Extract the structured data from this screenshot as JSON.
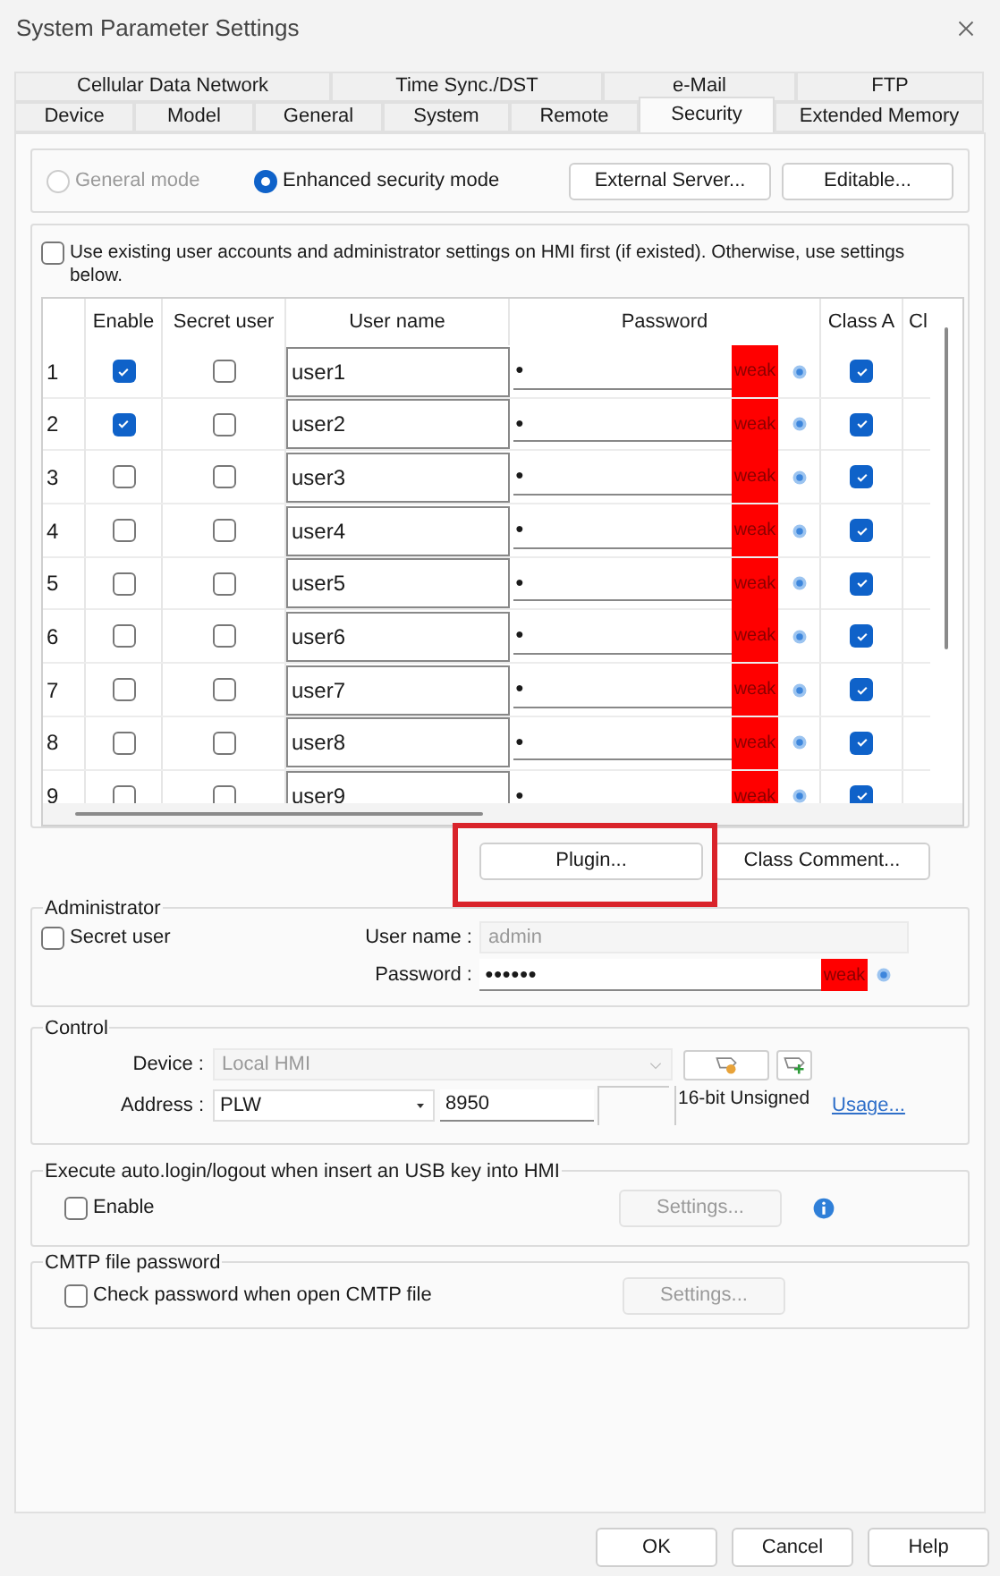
{
  "window": {
    "title": "System Parameter Settings"
  },
  "tab_rows": [
    [
      {
        "label": "Cellular Data Network",
        "selected": false
      },
      {
        "label": "Time Sync./DST",
        "selected": false
      },
      {
        "label": "e-Mail",
        "selected": false
      },
      {
        "label": "FTP",
        "selected": false
      }
    ],
    [
      {
        "label": "Device",
        "selected": false
      },
      {
        "label": "Model",
        "selected": false
      },
      {
        "label": "General",
        "selected": false
      },
      {
        "label": "System",
        "selected": false
      },
      {
        "label": "Remote",
        "selected": false
      },
      {
        "label": "Security",
        "selected": true
      },
      {
        "label": "Extended Memory",
        "selected": false
      }
    ]
  ],
  "modes": [
    {
      "label": "General mode",
      "selected": false,
      "disabled": true
    },
    {
      "label": "Enhanced security mode",
      "selected": true,
      "disabled": false
    }
  ],
  "mode_buttons": [
    "External Server...",
    "Editable..."
  ],
  "use_existing": {
    "label": "Use existing user accounts and administrator settings on HMI first (if existed). Otherwise, use settings below.",
    "checked": false
  },
  "users_table": {
    "columns": [
      "Enable",
      "Secret user",
      "User name",
      "Password",
      "Class A",
      "Cl"
    ],
    "rows": [
      {
        "number": "1",
        "enable": true,
        "secret": false,
        "user_name": "user1",
        "password": "●",
        "strength": "weak",
        "class_a": true
      },
      {
        "number": "2",
        "enable": true,
        "secret": false,
        "user_name": "user2",
        "password": "●",
        "strength": "weak",
        "class_a": true
      },
      {
        "number": "3",
        "enable": false,
        "secret": false,
        "user_name": "user3",
        "password": "●",
        "strength": "weak",
        "class_a": true
      },
      {
        "number": "4",
        "enable": false,
        "secret": false,
        "user_name": "user4",
        "password": "●",
        "strength": "weak",
        "class_a": true
      },
      {
        "number": "5",
        "enable": false,
        "secret": false,
        "user_name": "user5",
        "password": "●",
        "strength": "weak",
        "class_a": true
      },
      {
        "number": "6",
        "enable": false,
        "secret": false,
        "user_name": "user6",
        "password": "●",
        "strength": "weak",
        "class_a": true
      },
      {
        "number": "7",
        "enable": false,
        "secret": false,
        "user_name": "user7",
        "password": "●",
        "strength": "weak",
        "class_a": true
      },
      {
        "number": "8",
        "enable": false,
        "secret": false,
        "user_name": "user8",
        "password": "●",
        "strength": "weak",
        "class_a": true
      },
      {
        "number": "9",
        "enable": false,
        "secret": false,
        "user_name": "user9",
        "password": "●",
        "strength": "weak",
        "class_a": true
      }
    ]
  },
  "table_buttons": [
    {
      "label": "Plugin...",
      "highlighted": true
    },
    {
      "label": "Class Comment...",
      "highlighted": false
    }
  ],
  "administrator": {
    "title": "Administrator",
    "secret_user": {
      "label": "Secret user",
      "checked": false
    },
    "user_name_label": "User name :",
    "user_name": "admin",
    "password_label": "Password :",
    "password": "●●●●●●",
    "strength": "weak"
  },
  "control": {
    "title": "Control",
    "device_label": "Device :",
    "device": "Local HMI",
    "address_label": "Address :",
    "address_type": "PLW",
    "address": "8950",
    "data_type": "16-bit Unsigned",
    "usage_link": "Usage..."
  },
  "usb_login": {
    "title": "Execute auto.login/logout when insert an USB key into HMI",
    "enable": {
      "label": "Enable",
      "checked": false
    },
    "settings": "Settings..."
  },
  "cmtp": {
    "title": "CMTP file password",
    "check": {
      "label": "Check password when open CMTP file",
      "checked": false
    },
    "settings": "Settings..."
  },
  "footer_buttons": [
    "OK",
    "Cancel",
    "Help"
  ]
}
